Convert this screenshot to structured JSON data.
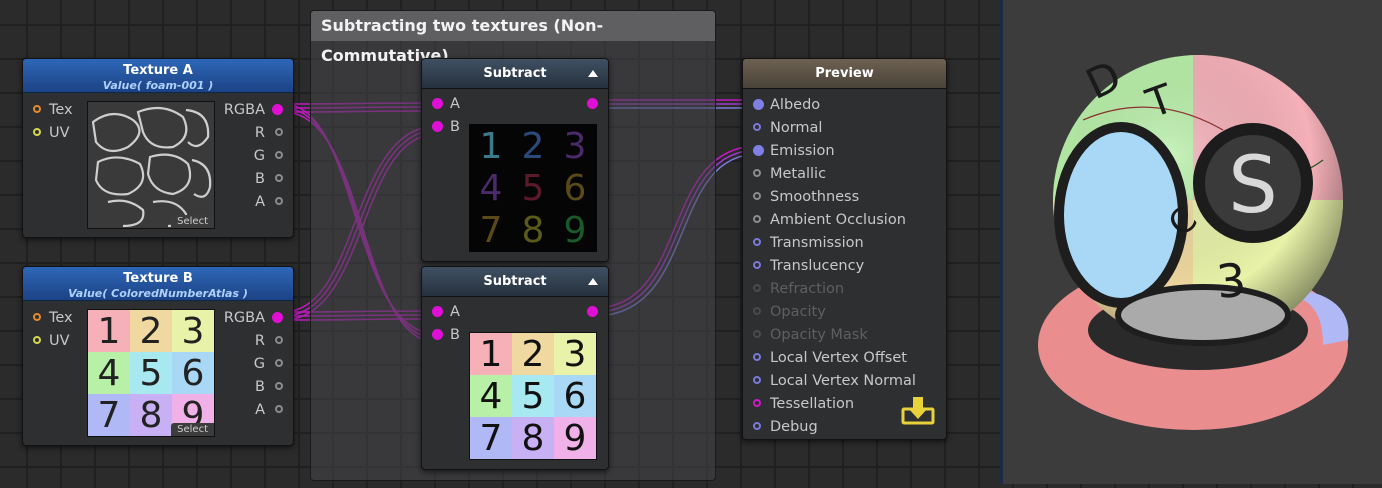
{
  "group": {
    "title": "Subtracting two textures (Non-Commutative)"
  },
  "texture_a": {
    "title": "Texture A",
    "value": "Value( foam-001 )",
    "in_tex": "Tex",
    "in_uv": "UV",
    "out_rgba": "RGBA",
    "out_r": "R",
    "out_g": "G",
    "out_b": "B",
    "out_a": "A",
    "select": "Select"
  },
  "texture_b": {
    "title": "Texture B",
    "value": "Value( ColoredNumberAtlas )",
    "in_tex": "Tex",
    "in_uv": "UV",
    "out_rgba": "RGBA",
    "out_r": "R",
    "out_g": "G",
    "out_b": "B",
    "out_a": "A",
    "select": "Select",
    "digits": [
      "1",
      "2",
      "3",
      "4",
      "5",
      "6",
      "7",
      "8",
      "9"
    ]
  },
  "subtract_1": {
    "title": "Subtract",
    "in_a": "A",
    "in_b": "B",
    "digits": [
      "1",
      "2",
      "3",
      "4",
      "5",
      "6",
      "7",
      "8",
      "9"
    ]
  },
  "subtract_2": {
    "title": "Subtract",
    "in_a": "A",
    "in_b": "B",
    "digits": [
      "1",
      "2",
      "3",
      "4",
      "5",
      "6",
      "7",
      "8",
      "9"
    ]
  },
  "preview": {
    "title": "Preview",
    "ports": [
      {
        "label": "Albedo",
        "state": "connected"
      },
      {
        "label": "Normal",
        "state": "active"
      },
      {
        "label": "Emission",
        "state": "connected"
      },
      {
        "label": "Metallic",
        "state": "gray"
      },
      {
        "label": "Smoothness",
        "state": "gray"
      },
      {
        "label": "Ambient Occlusion",
        "state": "gray"
      },
      {
        "label": "Transmission",
        "state": "active"
      },
      {
        "label": "Translucency",
        "state": "active"
      },
      {
        "label": "Refraction",
        "state": "disabled"
      },
      {
        "label": "Opacity",
        "state": "disabled"
      },
      {
        "label": "Opacity Mask",
        "state": "disabled"
      },
      {
        "label": "Local Vertex Offset",
        "state": "active"
      },
      {
        "label": "Local Vertex Normal",
        "state": "active"
      },
      {
        "label": "Tessellation",
        "state": "magenta"
      },
      {
        "label": "Debug",
        "state": "active"
      }
    ]
  },
  "render_preview": {
    "logo_letter": "S",
    "sphere_letters": [
      "D",
      "T",
      "C",
      "3"
    ]
  },
  "colors": {
    "wire": "#c21bc4",
    "wire_blue": "#7a7adb",
    "header_blue": "#2e67b8",
    "panel_accent": "#e7d23a"
  }
}
